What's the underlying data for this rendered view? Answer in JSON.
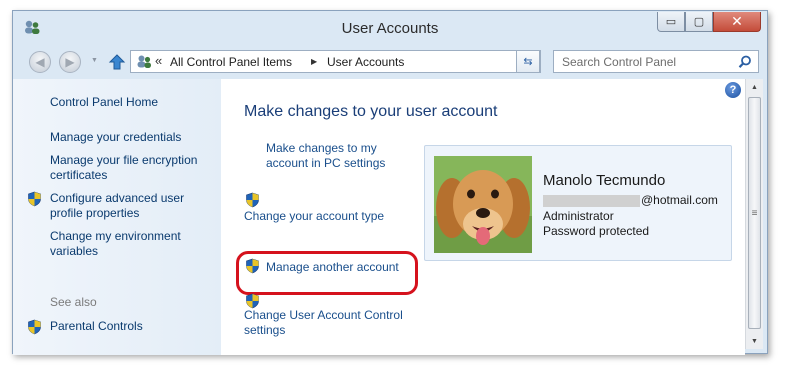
{
  "window": {
    "title": "User Accounts",
    "minimize_label": "▭",
    "maximize_label": "▢",
    "close_label": "✕"
  },
  "nav": {
    "back_icon": "back-arrow-icon",
    "forward_icon": "forward-arrow-icon",
    "address": {
      "chevron": "«",
      "items": [
        "All Control Panel Items",
        "User Accounts"
      ]
    },
    "search_placeholder": "Search Control Panel"
  },
  "sidebar": {
    "home": "Control Panel Home",
    "items": [
      "Manage your credentials",
      "Manage your file encryption certificates",
      "Configure advanced user profile properties",
      "Change my environment variables"
    ],
    "see_also_label": "See also",
    "see_also_items": [
      "Parental Controls"
    ]
  },
  "main": {
    "heading": "Make changes to your user account",
    "tasks": [
      "Make changes to my account in PC settings",
      "Change your account type",
      "Manage another account",
      "Change User Account Control settings"
    ]
  },
  "account": {
    "name": "Manolo Tecmundo",
    "email_suffix": "@hotmail.com",
    "type": "Administrator",
    "status": "Password protected"
  },
  "colors": {
    "link": "#1a4f8c",
    "heading": "#1a3e78",
    "highlight": "#d5121d",
    "sidebar_bg": "#e3edf7"
  }
}
